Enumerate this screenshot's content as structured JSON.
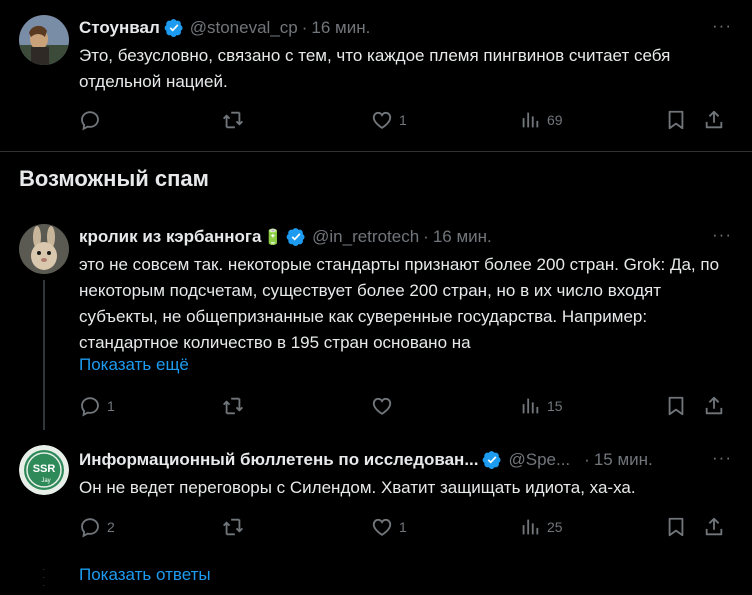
{
  "tweet1": {
    "name": "Стоунвал",
    "handle": "@stoneval_cp",
    "time": "16 мин.",
    "text": "Это, безусловно, связано с тем, что каждое племя пингвинов считает себя отдельной нацией.",
    "likes": "1",
    "views": "69"
  },
  "section_title": "Возможный спам",
  "tweet2": {
    "name": "кролик из кэрбаннога",
    "name_emoji": "🔋",
    "handle": "@in_retrotech",
    "time": "16 мин.",
    "text": "это не совсем так. некоторые стандарты признают более 200 стран. Grok: Да, по некоторым подсчетам, существует более 200 стран, но в их число входят субъекты, не общепризнанные как суверенные государства. Например: стандартное количество в 195 стран основано на",
    "show_more": "Показать ещё",
    "replies": "1",
    "views": "15"
  },
  "tweet3": {
    "name": "Информационный бюллетень по исследован...",
    "handle": "@Spe...",
    "time": "15 мин.",
    "avatar_text": "SSR",
    "avatar_sub": "Jay",
    "text": "Он не ведет переговоры с Силендом. Хватит защищать идиота, ха-ха.",
    "replies": "2",
    "likes": "1",
    "views": "25"
  },
  "show_replies": "Показать ответы",
  "more_glyph": "···",
  "icons": [
    "reply-icon",
    "retweet-icon",
    "like-icon",
    "views-icon",
    "bookmark-icon",
    "share-icon",
    "verified-icon",
    "more-icon"
  ],
  "colors": {
    "background": "#000000",
    "text": "#e7e9ea",
    "muted": "#71767b",
    "link": "#1d9bf0",
    "verified": "#1d9bf0"
  }
}
